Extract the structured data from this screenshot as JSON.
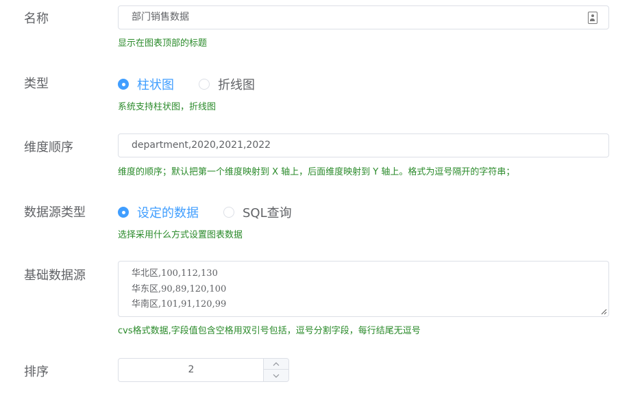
{
  "form": {
    "name": {
      "label": "名称",
      "value": "部门销售数据",
      "hint": "显示在图表顶部的标题"
    },
    "type": {
      "label": "类型",
      "options": [
        {
          "label": "柱状图",
          "checked": true
        },
        {
          "label": "折线图",
          "checked": false
        }
      ],
      "hint": "系统支持柱状图，折线图"
    },
    "dimension_order": {
      "label": "维度顺序",
      "value": "department,2020,2021,2022",
      "hint": "维度的顺序；默认把第一个维度映射到 X 轴上，后面维度映射到 Y 轴上。格式为逗号隔开的字符串；"
    },
    "datasource_type": {
      "label": "数据源类型",
      "options": [
        {
          "label": "设定的数据",
          "checked": true
        },
        {
          "label": "SQL查询",
          "checked": false
        }
      ],
      "hint": "选择采用什么方式设置图表数据"
    },
    "base_datasource": {
      "label": "基础数据源",
      "lines": [
        "华北区,100,112,130",
        "华东区,90,89,120,100",
        "华南区,101,91,120,99"
      ],
      "hint": "cvs格式数据,字段值包含空格用双引号包括，逗号分割字段，每行结尾无逗号"
    },
    "sort": {
      "label": "排序",
      "value": "2"
    }
  },
  "colors": {
    "primary": "#409eff",
    "hint": "#2a8a2a",
    "border": "#dcdfe6",
    "text": "#606266"
  },
  "icons": {
    "name_suffix": "contact-card-icon",
    "stepper_up": "chevron-up-icon",
    "stepper_down": "chevron-down-icon"
  }
}
